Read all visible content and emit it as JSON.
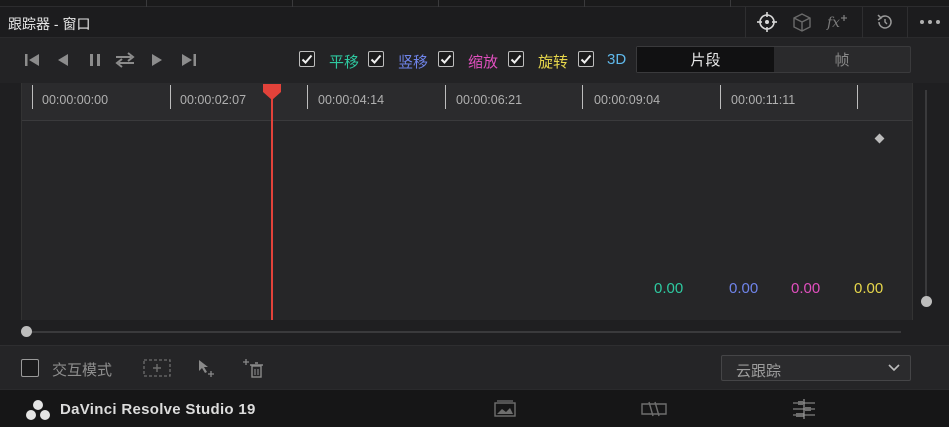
{
  "panel": {
    "title": "跟踪器 - 窗口"
  },
  "toolbar": {
    "checkboxes": [
      {
        "label": "平移",
        "color": "#2ec9a0",
        "checked": true
      },
      {
        "label": "竖移",
        "color": "#6f84ea",
        "checked": true
      },
      {
        "label": "缩放",
        "color": "#e04fbe",
        "checked": true
      },
      {
        "label": "旋转",
        "color": "#e6d64b",
        "checked": true
      },
      {
        "label": "3D",
        "color": "#5fb8ea",
        "checked": true
      }
    ],
    "segment": {
      "options": [
        "片段",
        "帧"
      ],
      "selected": "片段"
    }
  },
  "timeline": {
    "timecodes": [
      "00:00:00:00",
      "00:00:02:07",
      "00:00:04:14",
      "00:00:06:21",
      "00:00:09:04",
      "00:00:11:11"
    ]
  },
  "values": [
    {
      "value": "0.00",
      "color": "#2ec9a0"
    },
    {
      "value": "0.00",
      "color": "#6f84ea"
    },
    {
      "value": "0.00",
      "color": "#e04fbe"
    },
    {
      "value": "0.00",
      "color": "#e6d64b"
    }
  ],
  "bottom": {
    "interact_label": "交互模式",
    "dropdown_value": "云跟踪"
  },
  "footer": {
    "brand": "DaVinci Resolve Studio 19"
  },
  "colors": {
    "playhead": "#e2423a",
    "accent_text": "#c8c8c8"
  }
}
